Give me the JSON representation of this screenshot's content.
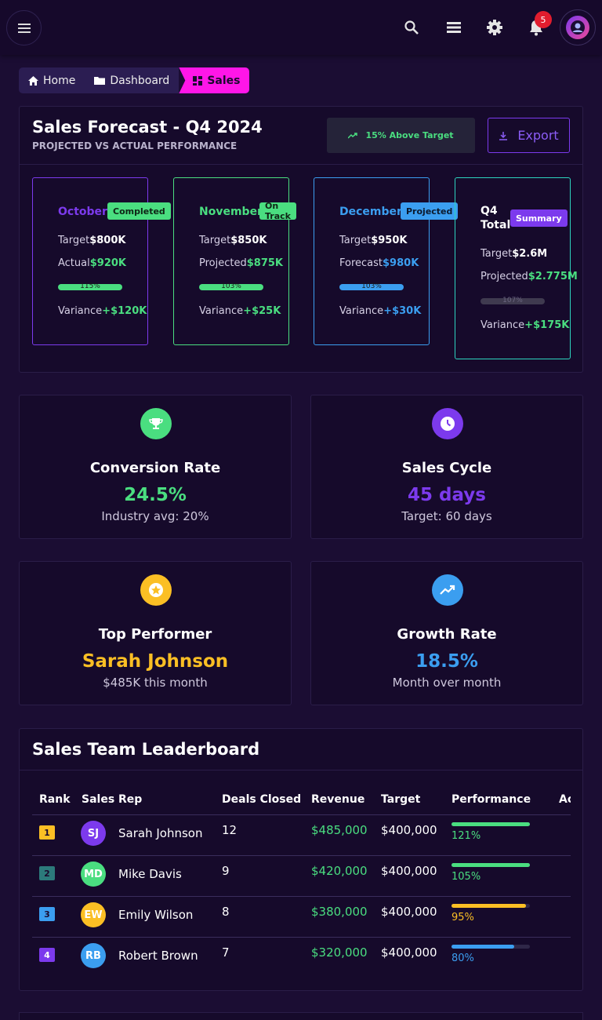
{
  "topbar": {
    "notifications": "5",
    "icons": [
      "menu-icon",
      "search-icon",
      "layers-icon",
      "settings-icon",
      "bell-icon",
      "avatar"
    ]
  },
  "breadcrumb": {
    "home": "Home",
    "dashboard": "Dashboard",
    "sales": "Sales"
  },
  "forecast": {
    "title": "Sales Forecast - Q4 2024",
    "subtitle": "PROJECTED VS ACTUAL PERFORMANCE",
    "above_target": "15% Above Target",
    "export": "Export",
    "months": [
      {
        "name": "October",
        "badge": "Completed",
        "row1_label": "Target",
        "row1_value": "$800K",
        "row2_label": "Actual",
        "row2_value": "$920K",
        "progress": "115%",
        "variance_label": "Variance",
        "variance_value": "+$120K"
      },
      {
        "name": "November",
        "badge": "On Track",
        "row1_label": "Target",
        "row1_value": "$850K",
        "row2_label": "Projected",
        "row2_value": "$875K",
        "progress": "103%",
        "variance_label": "Variance",
        "variance_value": "+$25K"
      },
      {
        "name": "December",
        "badge": "Projected",
        "row1_label": "Target",
        "row1_value": "$950K",
        "row2_label": "Forecast",
        "row2_value": "$980K",
        "progress": "103%",
        "variance_label": "Variance",
        "variance_value": "+$30K"
      },
      {
        "name_line1": "Q4",
        "name_line2": "Total",
        "badge": "Summary",
        "row1_label": "Target",
        "row1_value": "$2.6M",
        "row2_label": "Projected",
        "row2_value": "$2.775M",
        "progress": "107%",
        "variance_label": "Variance",
        "variance_value": "+$175K"
      }
    ]
  },
  "stats": {
    "conversion": {
      "label": "Conversion Rate",
      "value": "24.5%",
      "note": "Industry avg: 20%"
    },
    "cycle": {
      "label": "Sales Cycle",
      "value": "45 days",
      "note": "Target: 60 days"
    },
    "top": {
      "label": "Top Performer",
      "value": "Sarah Johnson",
      "note": "$485K this month"
    },
    "growth": {
      "label": "Growth Rate",
      "value": "18.5%",
      "note": "Month over month"
    }
  },
  "leaderboard": {
    "title": "Sales Team Leaderboard",
    "headers": {
      "rank": "Rank",
      "rep": "Sales Rep",
      "deals": "Deals Closed",
      "revenue": "Revenue",
      "target": "Target",
      "performance": "Performance",
      "actions": "Actions"
    },
    "rows": [
      {
        "rank": "1",
        "initials": "SJ",
        "name": "Sarah Johnson",
        "deals": "12",
        "revenue": "$485,000",
        "target": "$400,000",
        "performance": "121%"
      },
      {
        "rank": "2",
        "initials": "MD",
        "name": "Mike Davis",
        "deals": "9",
        "revenue": "$420,000",
        "target": "$400,000",
        "performance": "105%"
      },
      {
        "rank": "3",
        "initials": "EW",
        "name": "Emily Wilson",
        "deals": "8",
        "revenue": "$380,000",
        "target": "$400,000",
        "performance": "95%"
      },
      {
        "rank": "4",
        "initials": "RB",
        "name": "Robert Brown",
        "deals": "7",
        "revenue": "$320,000",
        "target": "$400,000",
        "performance": "80%"
      }
    ]
  },
  "colors": {
    "background": "#1b0d33",
    "purple": "#7c3aed",
    "green": "#4ade80",
    "blue": "#3b9ef0",
    "yellow": "#fbbf24",
    "magenta": "#ff16e8",
    "teal": "#2dd4bf"
  }
}
